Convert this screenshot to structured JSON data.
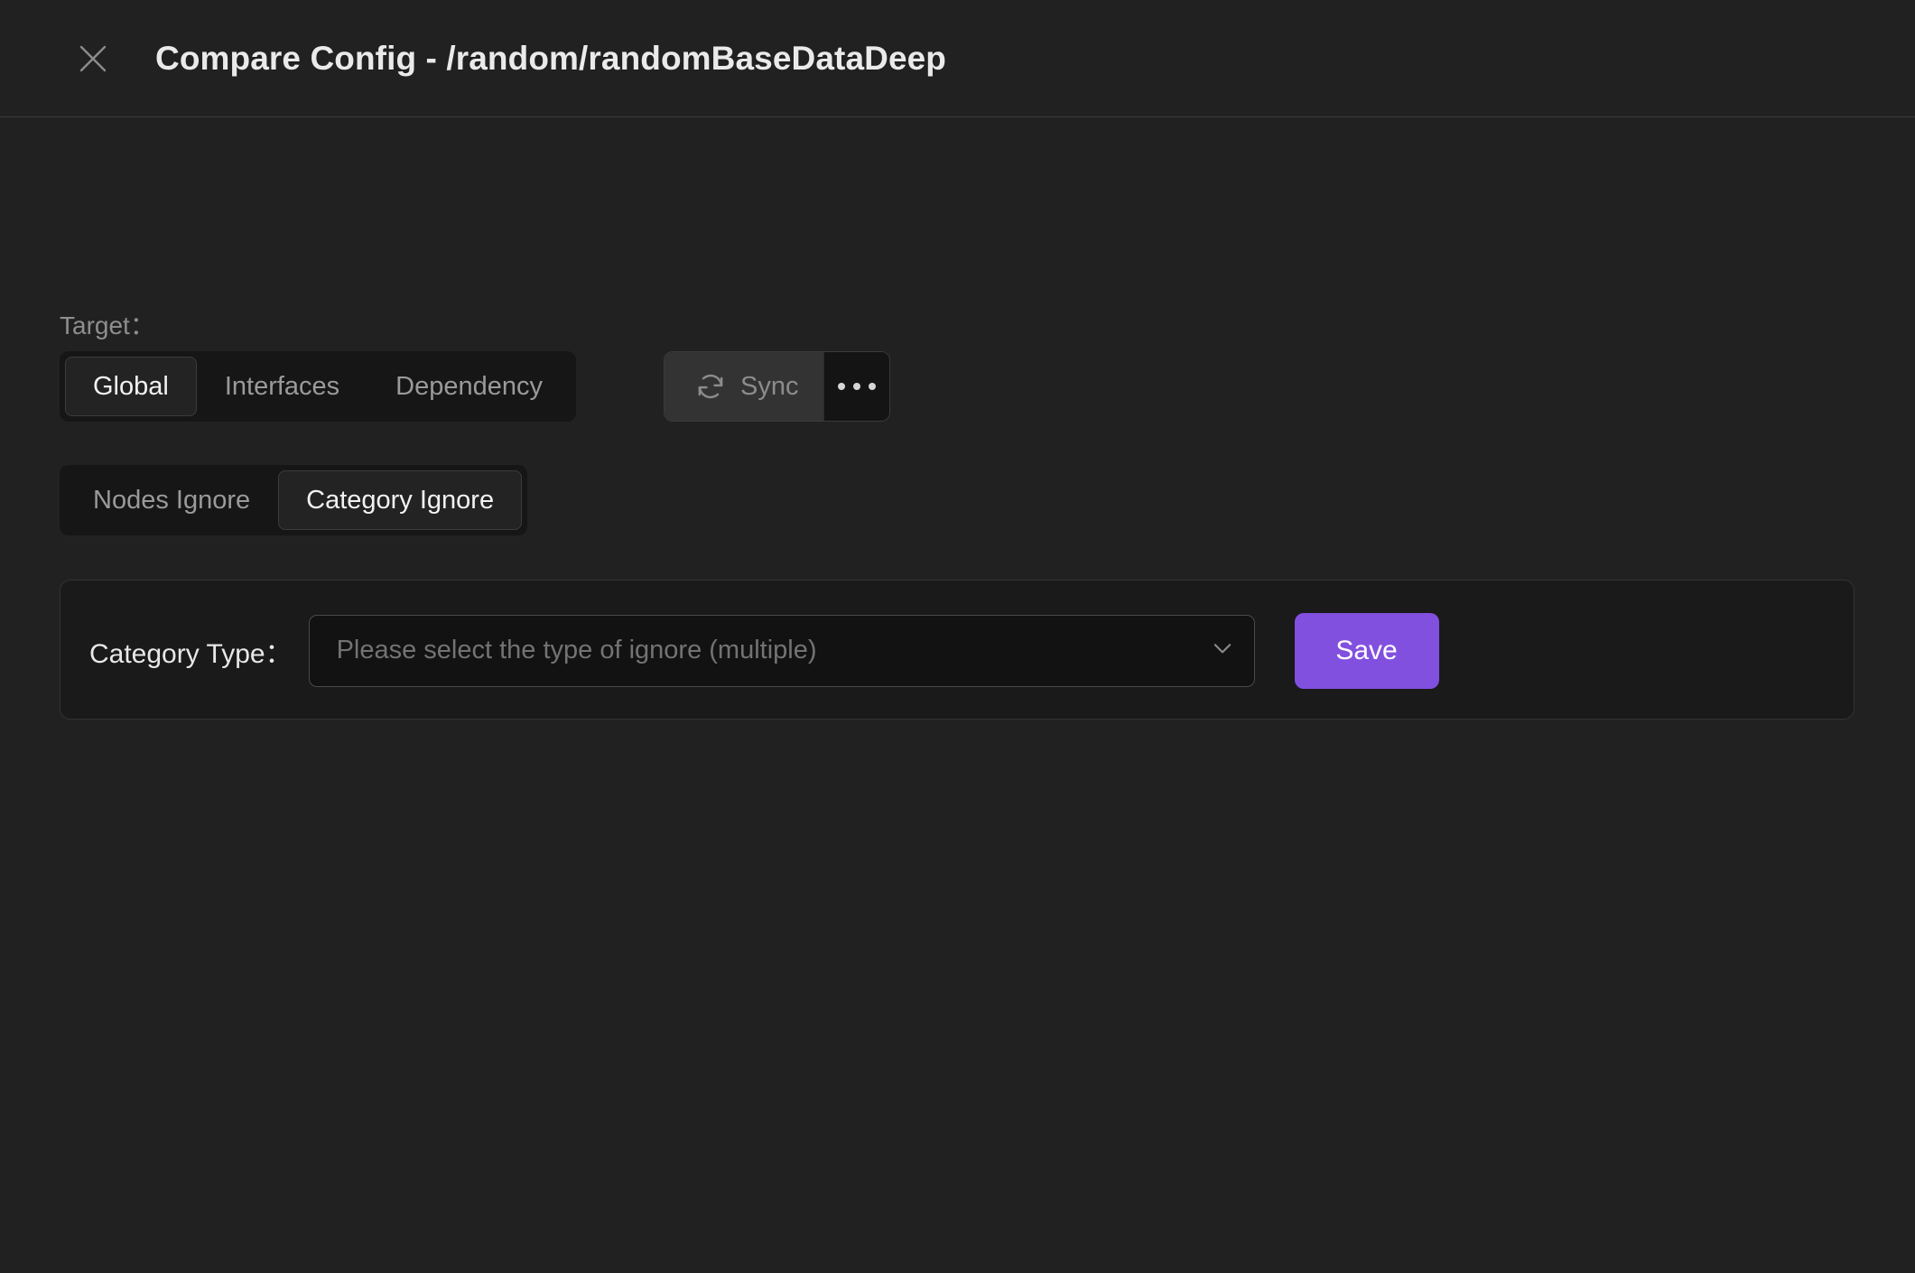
{
  "header": {
    "close_icon": "close-icon",
    "title": "Compare Config - /random/randomBaseDataDeep"
  },
  "target": {
    "label": "Target：",
    "tabs": [
      {
        "label": "Global",
        "active": true
      },
      {
        "label": "Interfaces",
        "active": false
      },
      {
        "label": "Dependency",
        "active": false
      }
    ],
    "sync": {
      "icon": "sync-icon",
      "label": "Sync",
      "disabled": true,
      "more_icon": "ellipsis-icon"
    }
  },
  "ignore": {
    "tabs": [
      {
        "label": "Nodes Ignore",
        "active": false
      },
      {
        "label": "Category Ignore",
        "active": true
      }
    ]
  },
  "form": {
    "category_type_label": "Category Type：",
    "select": {
      "value": "",
      "placeholder": "Please select the type of ignore (multiple)",
      "chevron_icon": "chevron-down-icon"
    },
    "save_label": "Save"
  },
  "colors": {
    "accent": "#8250df",
    "page_bg": "#212121",
    "card_bg": "#1a1a1a",
    "tab_group_bg": "#161616",
    "tab_active_bg": "#232323",
    "text_primary": "#eaeaea",
    "text_muted": "#8e8e8e"
  }
}
